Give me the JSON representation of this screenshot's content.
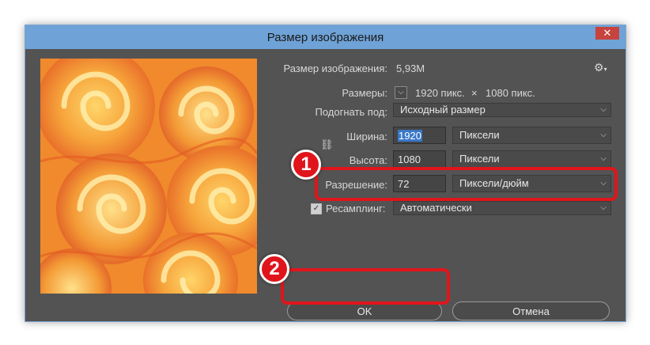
{
  "window": {
    "title": "Размер изображения",
    "close_glyph": "✕"
  },
  "info": {
    "image_size_label": "Размер изображения:",
    "image_size_value": "5,93М",
    "settings_icon": "gear-icon"
  },
  "dimensions": {
    "label": "Размеры:",
    "width": "1920 пикс.",
    "separator": "×",
    "height": "1080 пикс."
  },
  "fit_to": {
    "label": "Подогнать под:",
    "value": "Исходный размер"
  },
  "width": {
    "label": "Ширина:",
    "value": "1920",
    "unit": "Пиксели"
  },
  "height": {
    "label": "Высота:",
    "value": "1080",
    "unit": "Пиксели"
  },
  "resolution": {
    "label": "Разрешение:",
    "value": "72",
    "unit": "Пиксели/дюйм"
  },
  "resample": {
    "label": "Ресамплинг:",
    "value": "Автоматически",
    "checked": true
  },
  "buttons": {
    "ok": "OK",
    "cancel": "Отмена"
  },
  "annotations": {
    "marker1": "1",
    "marker2": "2"
  },
  "colors": {
    "highlight": "#e0151b",
    "titlebar": "#6fa2d6",
    "dialog_bg": "#535353"
  }
}
